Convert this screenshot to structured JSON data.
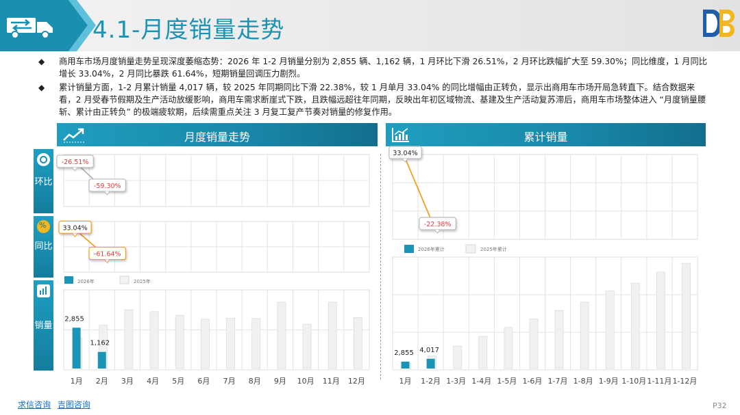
{
  "header": {
    "title": "4.1-月度销量走势"
  },
  "bullets": [
    "商用车市场月度销量走势呈现深度萎缩态势：2026 年 1-2 月销量分别为 2,855 辆、1,162 辆，1 月环比下滑 26.51%，2 月环比跌幅扩大至 59.30%；同比维度，1 月同比增长 33.04%，2 月同比暴跌 61.64%，短期销量回调压力剧烈。",
    "累计销量方面，1-2 月累计销量 4,017 辆，较 2025 年同期同比下滑 22.38%，较 1 月单月 33.04% 的同比增幅由正转负，显示出商用车市场开局急转直下。结合数据来看，2 月受春节假期及生产活动放缓影响，商用车需求断崖式下跌，且跌幅远超往年同期，反映出年初区域物流、基建及生产活动复苏滞后，商用车市场整体进入 “月度销量腰斩、累计由正转负” 的极端疲软期，后续需重点关注 3 月复工复产节奏对销量的修复作用。"
  ],
  "panels": {
    "left_title": "月度销量走势",
    "right_title": "累计销量",
    "side_labels": {
      "mom": "环比",
      "yoy": "同比",
      "sales": "销量"
    },
    "icons": {
      "mom": "ring-icon",
      "yoy": "percent-icon",
      "sales": "bar-chart-icon",
      "trend": "trend-up-icon",
      "cumulative": "cumulative-chart-icon"
    }
  },
  "footer": {
    "link1": "求信咨询",
    "link2": "吉图咨询",
    "page": "P32"
  },
  "colors": {
    "accent": "#1b93b4",
    "bar2026": "#1b94b6",
    "bar2025": "#ececec",
    "label_positive": "#222222",
    "label_negative": "#e23b3b",
    "mom_line": "#a9a9a9",
    "yoy_line": "#f0a020"
  },
  "chart_data": [
    {
      "type": "line",
      "chart": "mom",
      "categories": [
        "1月",
        "2月",
        "3月",
        "4月",
        "5月",
        "6月",
        "7月",
        "8月",
        "9月",
        "10月",
        "11月",
        "12月"
      ],
      "series": [
        {
          "values": [
            -26.51,
            -59.3
          ]
        }
      ],
      "labels": [
        "-26.51%",
        "-59.30%"
      ]
    },
    {
      "type": "line",
      "chart": "yoy",
      "categories": [
        "1月",
        "2月",
        "3月",
        "4月",
        "5月",
        "6月",
        "7月",
        "8月",
        "9月",
        "10月",
        "11月",
        "12月"
      ],
      "series": [
        {
          "values": [
            33.04,
            -61.64
          ]
        }
      ],
      "labels": [
        "33.04%",
        "-61.64%"
      ]
    },
    {
      "type": "bar",
      "chart": "monthly_sales",
      "categories": [
        "1月",
        "2月",
        "3月",
        "4月",
        "5月",
        "6月",
        "7月",
        "8月",
        "9月",
        "10月",
        "11月",
        "12月"
      ],
      "series": [
        {
          "name": "2026年",
          "values": [
            2855,
            1162
          ]
        },
        {
          "name": "2025年",
          "values": [
            2146,
            3030,
            4100,
            3980,
            3720,
            3450,
            3520,
            3500,
            4650,
            3090,
            4650,
            3570
          ]
        }
      ],
      "data_labels": [
        "2,855",
        "1,162"
      ],
      "ylim": [
        0,
        5500
      ]
    },
    {
      "type": "line",
      "chart": "cumulative_yoy",
      "categories": [
        "1月",
        "1-2月"
      ],
      "series": [
        {
          "values": [
            33.04,
            -22.38
          ]
        }
      ],
      "labels": [
        "33.04%",
        "-22.38%"
      ]
    },
    {
      "type": "bar",
      "chart": "cumulative_sales",
      "categories": [
        "1月",
        "1-2月",
        "1-3月",
        "1-4月",
        "1-5月",
        "1-6月",
        "1-7月",
        "1-8月",
        "1-9月",
        "1-10月",
        "1-11月",
        "1-12月"
      ],
      "series": [
        {
          "name": "2026年累计",
          "values": [
            2855,
            4017
          ]
        },
        {
          "name": "2025年累计",
          "values": [
            2146,
            5176,
            9276,
            13256,
            16976,
            20426,
            23946,
            27446,
            32096,
            35186,
            39836,
            43406
          ]
        }
      ],
      "data_labels": [
        "2,855",
        "4,017"
      ],
      "ylim": [
        0,
        46000
      ]
    }
  ]
}
